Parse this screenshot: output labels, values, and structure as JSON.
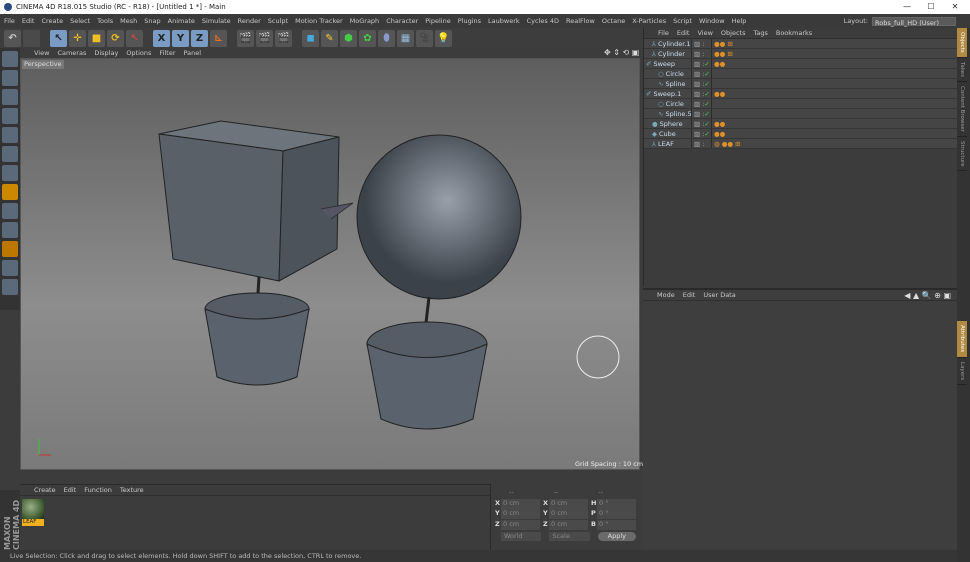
{
  "window": {
    "title": "CINEMA 4D R18.015 Studio (RC - R18) - [Untitled 1 *] - Main",
    "controls": [
      "—",
      "☐",
      "✕"
    ]
  },
  "menu": [
    "File",
    "Edit",
    "Create",
    "Select",
    "Tools",
    "Mesh",
    "Snap",
    "Animate",
    "Simulate",
    "Render",
    "Sculpt",
    "Motion Tracker",
    "MoGraph",
    "Character",
    "Pipeline",
    "Plugins",
    "Laubwerk",
    "Cycles 4D",
    "RealFlow",
    "Octane",
    "X-Particles",
    "Script",
    "Window",
    "Help"
  ],
  "layout": {
    "label": "Layout:",
    "value": "Robs_full_HD (User)"
  },
  "toolbar": {
    "axes": [
      "X",
      "Y",
      "Z"
    ]
  },
  "viewport": {
    "menu": [
      "View",
      "Cameras",
      "Display",
      "Options",
      "Filter",
      "Panel"
    ],
    "camera": "Perspective",
    "grid_spacing": "Grid Spacing : 10 cm"
  },
  "object_manager": {
    "menu": [
      "File",
      "Edit",
      "View",
      "Objects",
      "Tags",
      "Bookmarks"
    ],
    "objects": [
      {
        "name": "Cylinder.1",
        "icon": "null-icon",
        "depth": 1,
        "check": false,
        "tags": "●● ⊞"
      },
      {
        "name": "Cylinder",
        "icon": "null-icon",
        "depth": 1,
        "check": false,
        "tags": "●● ⊞"
      },
      {
        "name": "Sweep",
        "icon": "sweep-icon",
        "depth": 0,
        "check": true,
        "tags": "●●"
      },
      {
        "name": "Circle",
        "icon": "circle-icon",
        "depth": 2,
        "check": true,
        "tags": ""
      },
      {
        "name": "Spline",
        "icon": "spline-icon",
        "depth": 2,
        "check": true,
        "tags": ""
      },
      {
        "name": "Sweep.1",
        "icon": "sweep-icon",
        "depth": 0,
        "check": true,
        "tags": "●●"
      },
      {
        "name": "Circle",
        "icon": "circle-icon",
        "depth": 2,
        "check": true,
        "tags": ""
      },
      {
        "name": "Spline.5",
        "icon": "spline-icon",
        "depth": 2,
        "check": true,
        "tags": ""
      },
      {
        "name": "Sphere",
        "icon": "sphere-icon",
        "depth": 1,
        "check": true,
        "tags": "●●"
      },
      {
        "name": "Cube",
        "icon": "cube-icon",
        "depth": 1,
        "check": true,
        "tags": "●●"
      },
      {
        "name": "LEAF",
        "icon": "null-icon",
        "depth": 1,
        "check": false,
        "tags": "◍ ●● ⊞"
      }
    ]
  },
  "right_tabs": [
    "Objects",
    "Takes",
    "Content Browser",
    "Structure",
    "Attributes",
    "Layers"
  ],
  "attributes": {
    "menu": [
      "Mode",
      "Edit",
      "User Data"
    ]
  },
  "material_manager": {
    "menu": [
      "Create",
      "Edit",
      "Function",
      "Texture"
    ],
    "materials": [
      {
        "name": "LEAF"
      }
    ]
  },
  "brand": "MAXON CINEMA 4D",
  "coordinates": {
    "headers": [
      "--",
      "--",
      "--"
    ],
    "rows": [
      [
        {
          "axis": "X",
          "value": "0 cm"
        },
        {
          "axis": "X",
          "value": "0 cm"
        },
        {
          "axis": "H",
          "value": "0 °"
        }
      ],
      [
        {
          "axis": "Y",
          "value": "0 cm"
        },
        {
          "axis": "Y",
          "value": "0 cm"
        },
        {
          "axis": "P",
          "value": "0 °"
        }
      ],
      [
        {
          "axis": "Z",
          "value": "0 cm"
        },
        {
          "axis": "Z",
          "value": "0 cm"
        },
        {
          "axis": "B",
          "value": "0 °"
        }
      ]
    ],
    "space": "World",
    "mode": "Scale",
    "apply": "Apply"
  },
  "status": "Live Selection: Click and drag to select elements. Hold down SHIFT to add to the selection, CTRL to remove."
}
